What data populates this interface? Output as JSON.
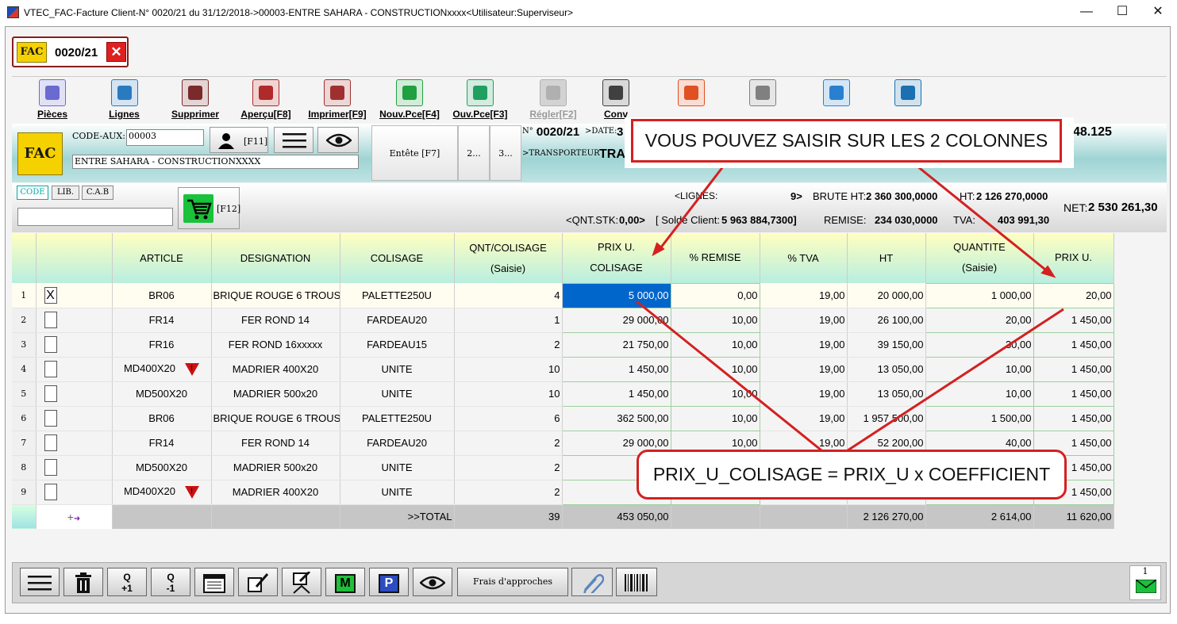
{
  "window": {
    "title": "VTEC_FAC-Facture Client-N° 0020/21 du 31/12/2018->00003-ENTRE SAHARA - CONSTRUCTIONxxxx<Utilisateur:Superviseur>",
    "minimize": "—",
    "maximize": "☐",
    "close": "✕"
  },
  "doc_tab": {
    "logo": "FAC",
    "number": "0020/21",
    "close": "✕"
  },
  "toolbar": [
    {
      "label": "Pièces",
      "icon": "grid-icon",
      "color": "#6a6ad0",
      "disabled": false
    },
    {
      "label": "Lignes",
      "icon": "magnifier-icon",
      "color": "#2a7ac0",
      "disabled": false
    },
    {
      "label": "Supprimer",
      "icon": "trash-icon",
      "color": "#7a2a2a",
      "disabled": false
    },
    {
      "label": "Aperçu[F8]",
      "icon": "preview-icon",
      "color": "#b02a2a",
      "disabled": false
    },
    {
      "label": "Imprimer[F9]",
      "icon": "printer-icon",
      "color": "#a03030",
      "disabled": false
    },
    {
      "label": "Nouv.Pce[F4]",
      "icon": "add-doc-icon",
      "color": "#20a040",
      "disabled": false
    },
    {
      "label": "Ouv.Pce[F3]",
      "icon": "open-doc-icon",
      "color": "#20a060",
      "disabled": false
    },
    {
      "label": "Régler[F2]",
      "icon": "map-icon",
      "color": "#b0b0b0",
      "disabled": true
    },
    {
      "label": "Conv",
      "icon": "convert-icon",
      "color": "#404040",
      "disabled": false
    },
    {
      "label": "",
      "icon": "validate-icon",
      "color": "#e05020",
      "disabled": false
    },
    {
      "label": "",
      "icon": "frame-icon",
      "color": "#808080",
      "disabled": false
    },
    {
      "label": "",
      "icon": "help-icon",
      "color": "#2a80d0",
      "disabled": false
    },
    {
      "label": "",
      "icon": "list-lines-icon",
      "color": "#1a70b0",
      "disabled": false
    }
  ],
  "header": {
    "code_aux_label": "CODE-AUX:",
    "code_aux_value": "00003",
    "f11": "[F11]",
    "client_name": "ENTRE SAHARA - CONSTRUCTIONXXXX",
    "entete_btn": "Entête [F7]",
    "tab2": "2...",
    "tab3": "3...",
    "num_label": "N° :",
    "num_value": "0020/21",
    "date_label": ">DATE:",
    "date_value": "3",
    "transporteur_label": ">TRANSPORTEUR :",
    "transporteur_value": "TRA",
    "right_value": "48.125"
  },
  "search": {
    "tabs": [
      "CODE",
      "LIB.",
      "C.A.B"
    ],
    "cart_key": "[F12]"
  },
  "summary": {
    "lignes_label": "<LIGNES:",
    "lignes_value": "9>",
    "brute_label": "BRUTE HT:",
    "brute_value": "2 360 300,0000",
    "ht_label": "HT:",
    "ht_value": "2 126 270,0000",
    "qnt_label": "<QNT.STK:",
    "qnt_value": "0,00>",
    "solde_label": "[ Solde Client:",
    "solde_value": "5 963 884,7300]",
    "remise_label": "REMISE:",
    "remise_value": "234 030,0000",
    "tva_label": "TVA:",
    "tva_value": "403 991,30",
    "net_label": "NET:",
    "net_value": "2 530 261,30"
  },
  "columns": [
    {
      "l1": "",
      "l2": ""
    },
    {
      "l1": "ARTICLE",
      "l2": ""
    },
    {
      "l1": "DESIGNATION",
      "l2": ""
    },
    {
      "l1": "COLISAGE",
      "l2": ""
    },
    {
      "l1": "QNT/COLISAGE",
      "l2": "(Saisie)"
    },
    {
      "l1": "PRIX U.",
      "l2": "COLISAGE"
    },
    {
      "l1": "% REMISE",
      "l2": ""
    },
    {
      "l1": "% TVA",
      "l2": ""
    },
    {
      "l1": "HT",
      "l2": ""
    },
    {
      "l1": "QUANTITE",
      "l2": "(Saisie)"
    },
    {
      "l1": "PRIX U.",
      "l2": ""
    }
  ],
  "rows": [
    {
      "n": "1",
      "check": "X",
      "article": "BR06",
      "warn": false,
      "designation": "BRIQUE ROUGE 6 TROUS",
      "colisage": "PALETTE250U",
      "qnt": "4",
      "pu_col": "5 000,00",
      "remise": "0,00",
      "tva": "19,00",
      "ht": "20 000,00",
      "quantite": "1 000,00",
      "pu": "20,00"
    },
    {
      "n": "2",
      "check": "",
      "article": "FR14",
      "warn": false,
      "designation": "FER ROND 14",
      "colisage": "FARDEAU20",
      "qnt": "1",
      "pu_col": "29 000,00",
      "remise": "10,00",
      "tva": "19,00",
      "ht": "26 100,00",
      "quantite": "20,00",
      "pu": "1 450,00"
    },
    {
      "n": "3",
      "check": "",
      "article": "FR16",
      "warn": false,
      "designation": "FER ROND 16xxxxx",
      "colisage": "FARDEAU15",
      "qnt": "2",
      "pu_col": "21 750,00",
      "remise": "10,00",
      "tva": "19,00",
      "ht": "39 150,00",
      "quantite": "30,00",
      "pu": "1 450,00"
    },
    {
      "n": "4",
      "check": "",
      "article": "MD400X20",
      "warn": true,
      "designation": "MADRIER 400X20",
      "colisage": "UNITE",
      "qnt": "10",
      "pu_col": "1 450,00",
      "remise": "10,00",
      "tva": "19,00",
      "ht": "13 050,00",
      "quantite": "10,00",
      "pu": "1 450,00"
    },
    {
      "n": "5",
      "check": "",
      "article": "MD500X20",
      "warn": false,
      "designation": "MADRIER 500x20",
      "colisage": "UNITE",
      "qnt": "10",
      "pu_col": "1 450,00",
      "remise": "10,00",
      "tva": "19,00",
      "ht": "13 050,00",
      "quantite": "10,00",
      "pu": "1 450,00"
    },
    {
      "n": "6",
      "check": "",
      "article": "BR06",
      "warn": false,
      "designation": "BRIQUE ROUGE 6 TROUS",
      "colisage": "PALETTE250U",
      "qnt": "6",
      "pu_col": "362 500,00",
      "remise": "10,00",
      "tva": "19,00",
      "ht": "1 957 500,00",
      "quantite": "1 500,00",
      "pu": "1 450,00"
    },
    {
      "n": "7",
      "check": "",
      "article": "FR14",
      "warn": false,
      "designation": "FER ROND 14",
      "colisage": "FARDEAU20",
      "qnt": "2",
      "pu_col": "29 000,00",
      "remise": "10,00",
      "tva": "19,00",
      "ht": "52 200,00",
      "quantite": "40,00",
      "pu": "1 450,00"
    },
    {
      "n": "8",
      "check": "",
      "article": "MD500X20",
      "warn": false,
      "designation": "MADRIER 500x20",
      "colisage": "UNITE",
      "qnt": "2",
      "pu_col": "",
      "remise": "",
      "tva": "",
      "ht": "",
      "quantite": "",
      "pu": "1 450,00"
    },
    {
      "n": "9",
      "check": "",
      "article": "MD400X20",
      "warn": true,
      "designation": "MADRIER 400X20",
      "colisage": "UNITE",
      "qnt": "2",
      "pu_col": "",
      "remise": "",
      "tva": "",
      "ht": "",
      "quantite": "",
      "pu": "1 450,00"
    }
  ],
  "totals": {
    "label": ">>TOTAL",
    "qnt": "39",
    "pu_col": "453 050,00",
    "ht": "2 126 270,00",
    "quantite": "2 614,00",
    "pu": "11 620,00"
  },
  "bottom_bar": {
    "q_plus": "Q\n+1",
    "q_minus": "Q\n-1",
    "m": "M",
    "p": "P",
    "frais": "Frais d'approches",
    "count": "1"
  },
  "callouts": {
    "top": "VOUS POUVEZ SAISIR SUR LES 2 COLONNES",
    "bottom": "PRIX_U_COLISAGE = PRIX_U x COEFFICIENT",
    "color": "#d42020"
  }
}
